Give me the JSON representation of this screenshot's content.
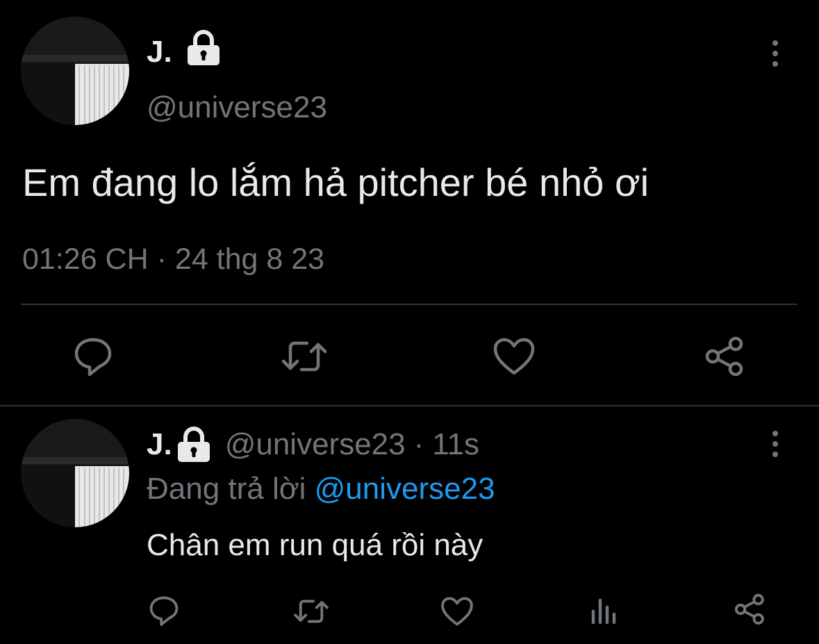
{
  "main_tweet": {
    "display_name": "J.",
    "handle": "@universe23",
    "text": "Em đang lo lắm hả pitcher bé nhỏ ơi",
    "time": "01:26 CH",
    "separator": "·",
    "date": "24 thg 8 23",
    "locked": true
  },
  "reply_tweet": {
    "display_name": "J.",
    "handle": "@universe23",
    "separator": "·",
    "age": "11s",
    "replying_prefix": "Đang trả lời",
    "replying_to": "@universe23",
    "text": "Chân em run quá rồi này",
    "locked": true
  },
  "actions": {
    "main": [
      "reply-icon",
      "retweet-icon",
      "like-icon",
      "share-icon"
    ],
    "reply": [
      "reply-icon",
      "retweet-icon",
      "like-icon",
      "views-icon",
      "share-icon"
    ]
  },
  "colors": {
    "background": "#000000",
    "text": "#e7e9ea",
    "muted": "#71767b",
    "link": "#1d9bf0",
    "divider": "#2f3336"
  }
}
